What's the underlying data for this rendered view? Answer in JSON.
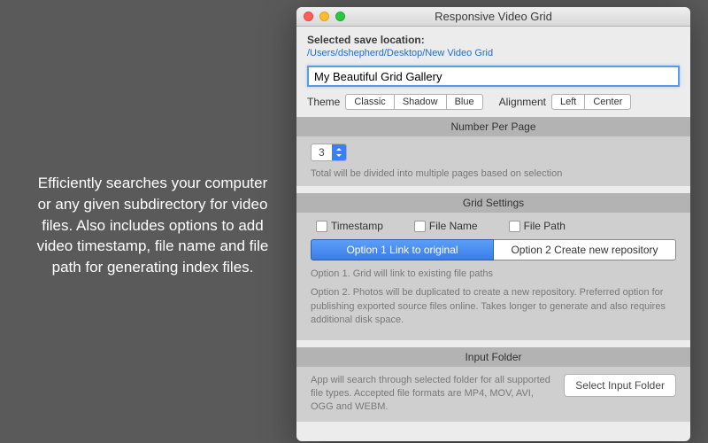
{
  "promo": "Efficiently searches your computer or any given subdirectory for video files. Also includes options to add video timestamp, file name and file path for generating index files.",
  "window": {
    "title": "Responsive Video Grid",
    "save_label": "Selected save location:",
    "save_path": "/Users/dshepherd/Desktop/New Video Grid",
    "title_input": "My Beautiful Grid Gallery",
    "theme_label": "Theme",
    "theme_options": {
      "a": "Classic",
      "b": "Shadow",
      "c": "Blue"
    },
    "align_label": "Alignment",
    "align_options": {
      "a": "Left",
      "b": "Center"
    }
  },
  "number_section": {
    "header": "Number Per Page",
    "value": "3",
    "hint": "Total will be divided into multiple pages based on selection"
  },
  "grid_section": {
    "header": "Grid Settings",
    "checks": {
      "a": "Timestamp",
      "b": "File Name",
      "c": "File Path"
    },
    "opt1": "Option 1 Link to original",
    "opt2": "Option 2 Create new repository",
    "desc1": "Option 1. Grid will link to existing file paths",
    "desc2": "Option 2. Photos will be duplicated to create a new repository. Preferred option for publishing exported source files online.  Takes longer to generate and also requires additional disk space."
  },
  "input_section": {
    "header": "Input Folder",
    "text": "App will search through selected folder for all supported file types.  Accepted file formats are MP4, MOV, AVI, OGG and WEBM.",
    "button": "Select Input Folder"
  }
}
